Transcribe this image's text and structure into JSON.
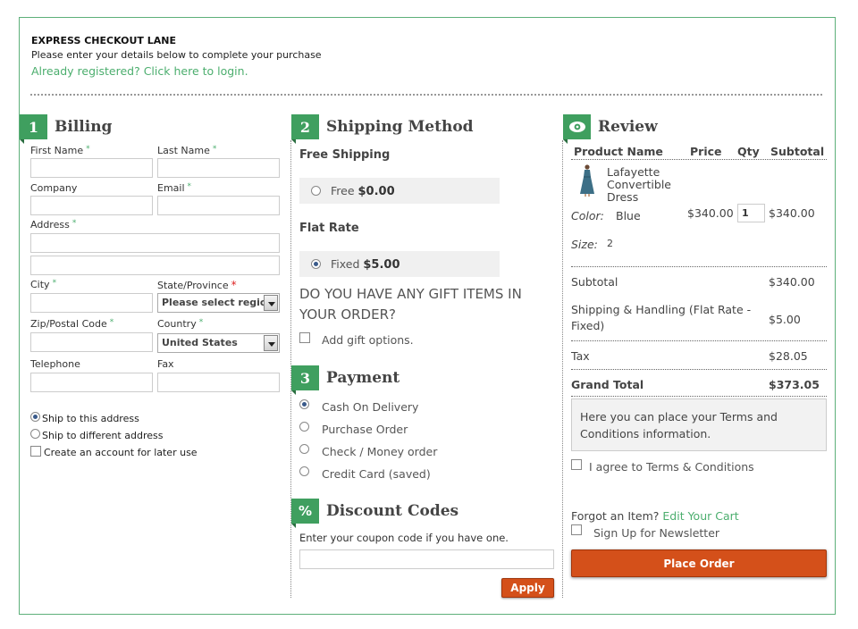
{
  "header": {
    "title": "EXPRESS CHECKOUT LANE",
    "subtitle": "Please enter your details below to complete your purchase",
    "login_link": "Already registered? Click here to login."
  },
  "billing": {
    "number": "1",
    "title": "Billing",
    "first_name_label": "First Name",
    "last_name_label": "Last Name",
    "company_label": "Company",
    "email_label": "Email",
    "address_label": "Address",
    "city_label": "City",
    "state_label": "State/Province",
    "state_value": "Please select region",
    "zip_label": "Zip/Postal Code",
    "country_label": "Country",
    "country_value": "United States",
    "telephone_label": "Telephone",
    "fax_label": "Fax",
    "required_mark": "*",
    "ship_same": "Ship to this address",
    "ship_different": "Ship to different address",
    "create_account": "Create an account for later use"
  },
  "shipping": {
    "number": "2",
    "title": "Shipping Method",
    "free_title": "Free Shipping",
    "free_label": "Free",
    "free_price": "$0.00",
    "flat_title": "Flat Rate",
    "flat_label": "Fixed",
    "flat_price": "$5.00",
    "gift_question": "DO YOU HAVE ANY GIFT ITEMS IN YOUR ORDER?",
    "gift_option": "Add gift options."
  },
  "payment": {
    "number": "3",
    "title": "Payment",
    "methods": [
      "Cash On Delivery",
      "Purchase Order",
      "Check / Money order",
      "Credit Card (saved)"
    ]
  },
  "discount": {
    "number": "%",
    "title": "Discount Codes",
    "note": "Enter your coupon code if you have one.",
    "apply_label": "Apply"
  },
  "review": {
    "title": "Review",
    "col_product": "Product Name",
    "col_price": "Price",
    "col_qty": "Qty",
    "col_subtotal": "Subtotal",
    "item": {
      "name_line1": "Lafayette",
      "name_line2": "Convertible",
      "name_line3": "Dress",
      "color_label": "Color:",
      "color_value": "Blue",
      "size_label": "Size:",
      "size_value": "2",
      "price": "$340.00",
      "qty": "1",
      "subtotal": "$340.00"
    },
    "subtotal_label": "Subtotal",
    "subtotal_value": "$340.00",
    "shipping_label": "Shipping & Handling (Flat Rate - Fixed)",
    "shipping_value": "$5.00",
    "tax_label": "Tax",
    "tax_value": "$28.05",
    "grand_label": "Grand Total",
    "grand_value": "$373.05",
    "terms_text": "Here you can place your Terms and Conditions information.",
    "agree_label": "I agree to Terms & Conditions",
    "forgot_text": "Forgot an Item?",
    "edit_cart": "Edit Your Cart",
    "newsletter": "Sign Up for Newsletter",
    "place_order": "Place Order"
  },
  "colors": {
    "accent_green": "#3f9f5f",
    "button_orange": "#d4501a"
  }
}
